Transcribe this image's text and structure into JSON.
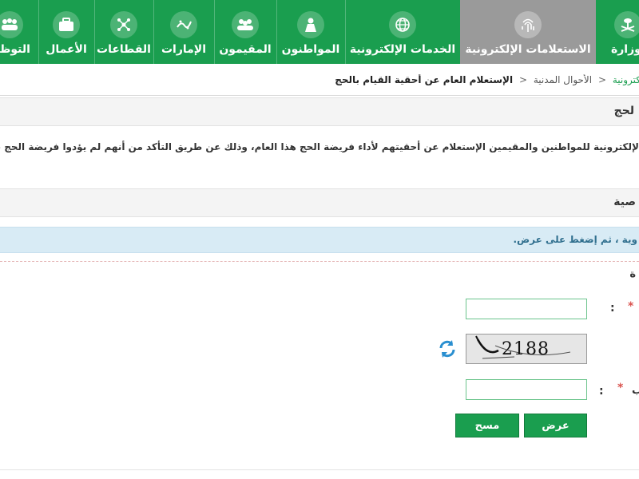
{
  "nav": {
    "items": [
      {
        "key": "ministry",
        "label": "الوزارة",
        "icon": "emblem-icon"
      },
      {
        "key": "eservices_inquiries",
        "label": "الاستعلامات الإلكترونية",
        "icon": "fingerprint-icon"
      },
      {
        "key": "eservices",
        "label": "الخدمات الإلكترونية",
        "icon": "globe-icon"
      },
      {
        "key": "citizens",
        "label": "المواطنون",
        "icon": "woman-icon"
      },
      {
        "key": "residents",
        "label": "المقيمون",
        "icon": "group-icon"
      },
      {
        "key": "emirates",
        "label": "الإمارات",
        "icon": "vision-logo-icon"
      },
      {
        "key": "sectors",
        "label": "القطاعات",
        "icon": "network-icon"
      },
      {
        "key": "business",
        "label": "الأعمال",
        "icon": "briefcase-icon"
      },
      {
        "key": "employment",
        "label": "التوظي",
        "icon": "people-icon"
      }
    ],
    "active": "eservices_inquiries",
    "colors": {
      "bar": "#1a9e4f",
      "active": "#9a9a9a"
    }
  },
  "breadcrumb": {
    "first": "كترونية",
    "second": "الأحوال المدنية",
    "current": "الإستعلام العام عن أحقية القيام بالحج"
  },
  "section_title": "لحج",
  "description": "الإلكترونية للمواطنين والمقيمين الإستعلام عن أحقيتهم لأداء فريضة الحج هذا العام، وذلك عن طريق التأكد من أنهم لم يؤدوا فريضة الحج في السنو",
  "form_section_title": "صية",
  "info_message": "وية ، ثم إضغط على عرض.",
  "sub_title": "ة",
  "fields": {
    "id_value": "",
    "captcha_text": "2188",
    "captcha_value": "",
    "id_label_clip": "",
    "captcha_label_clip": "ب"
  },
  "buttons": {
    "display": "عرض",
    "clear": "مسح"
  }
}
